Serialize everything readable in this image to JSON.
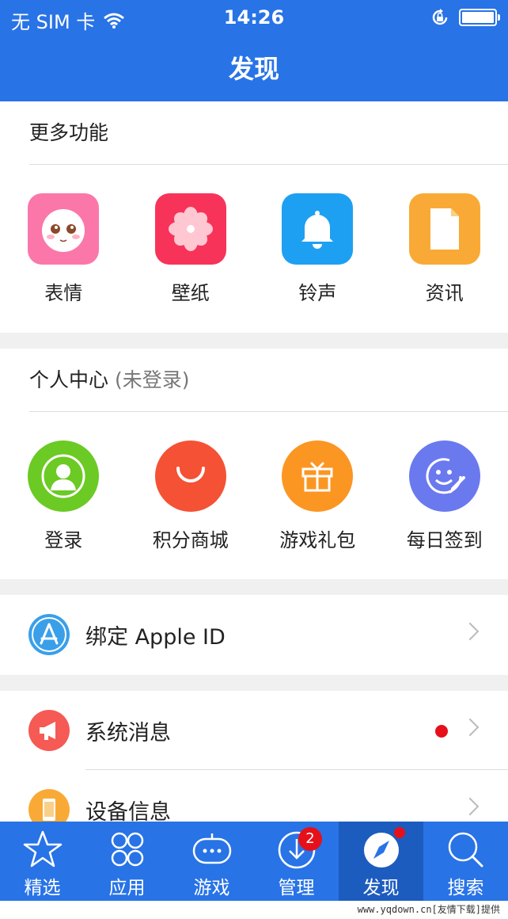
{
  "status_bar": {
    "carrier": "无 SIM 卡",
    "time": "14:26"
  },
  "nav": {
    "title": "发现"
  },
  "more_features": {
    "title": "更多功能",
    "items": [
      {
        "label": "表情",
        "icon": "emoji-face-icon",
        "color": "#fb77a9"
      },
      {
        "label": "壁纸",
        "icon": "flower-wallpaper-icon",
        "color": "#f7335a"
      },
      {
        "label": "铃声",
        "icon": "bell-icon",
        "color": "#1ea0f2"
      },
      {
        "label": "资讯",
        "icon": "document-icon",
        "color": "#f9aa36"
      }
    ]
  },
  "personal_center": {
    "title": "个人中心",
    "subtitle": "(未登录)",
    "items": [
      {
        "label": "登录",
        "icon": "user-icon",
        "color": "#6bca23"
      },
      {
        "label": "积分商城",
        "icon": "smile-arc-icon",
        "color": "#f55134"
      },
      {
        "label": "游戏礼包",
        "icon": "gift-icon",
        "color": "#fb9622"
      },
      {
        "label": "每日签到",
        "icon": "signin-smile-icon",
        "color": "#6b79ef"
      }
    ]
  },
  "rows": {
    "apple_id": {
      "label": "绑定 Apple ID",
      "icon": "app-store-icon",
      "color": "#3a9fe9"
    },
    "system_messages": {
      "label": "系统消息",
      "icon": "megaphone-icon",
      "color": "#f55a55"
    },
    "device_info": {
      "label": "设备信息",
      "icon": "phone-icon",
      "color": "#f9aa36"
    }
  },
  "tabbar": {
    "items": [
      {
        "label": "精选",
        "icon": "star-icon"
      },
      {
        "label": "应用",
        "icon": "apps-grid-icon"
      },
      {
        "label": "游戏",
        "icon": "gamepad-icon"
      },
      {
        "label": "管理",
        "icon": "download-icon",
        "badge": "2"
      },
      {
        "label": "发现",
        "icon": "compass-icon",
        "active": true
      },
      {
        "label": "搜索",
        "icon": "search-icon"
      }
    ]
  },
  "watermark": "www.yqdown.cn[友情下载]提供"
}
